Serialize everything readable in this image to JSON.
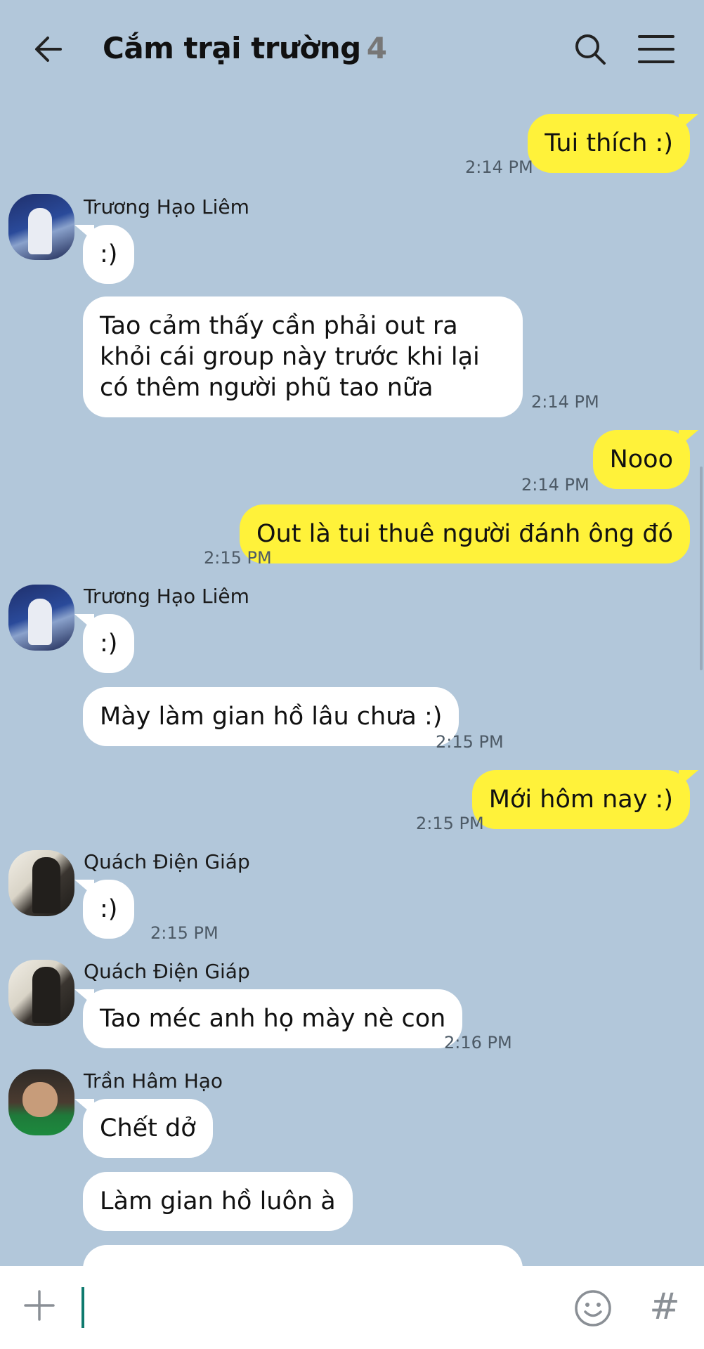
{
  "header": {
    "title": "Cắm trại trường",
    "member_count": "4",
    "icons": {
      "back": "back-arrow-icon",
      "search": "search-icon",
      "menu": "hamburger-menu-icon"
    }
  },
  "colors": {
    "background": "#b2c7da",
    "my_bubble": "#fff23a",
    "their_bubble": "#ffffff",
    "caret": "#0f7a6e"
  },
  "messages": [
    {
      "from": "me",
      "text": "Tui thích :)",
      "time": "2:14 PM"
    },
    {
      "from": "Trương Hạo Liêm",
      "sender_label": "Trương Hạo Liêm",
      "text": ":)"
    },
    {
      "from": "Trương Hạo Liêm",
      "text": "Tao cảm thấy cần phải out ra khỏi cái group này trước khi lại có thêm người phũ tao nữa",
      "time": "2:14 PM"
    },
    {
      "from": "me",
      "text": "Nooo",
      "time": "2:14 PM"
    },
    {
      "from": "me",
      "text": "Out là tui thuê người đánh ông đó",
      "time": "2:15 PM"
    },
    {
      "from": "Trương Hạo Liêm",
      "sender_label": "Trương Hạo Liêm",
      "text": ":)"
    },
    {
      "from": "Trương Hạo Liêm",
      "text": "Mày làm gian hồ lâu chưa :)",
      "time": "2:15 PM"
    },
    {
      "from": "me",
      "text": "Mới hôm nay :)",
      "time": "2:15 PM"
    },
    {
      "from": "Quách Điện Giáp",
      "sender_label": "Quách Điện Giáp",
      "text": ":)",
      "time": "2:15 PM"
    },
    {
      "from": "Quách Điện Giáp",
      "sender_label": "Quách Điện Giáp",
      "text": "Tao méc anh họ mày nè con",
      "time": "2:16 PM"
    },
    {
      "from": "Trần Hâm Hạo",
      "sender_label": "Trần Hâm Hạo",
      "text": "Chết dở"
    },
    {
      "from": "Trần Hâm Hạo",
      "text": "Làm gian hồ luôn à"
    }
  ],
  "input_bar": {
    "placeholder": "",
    "value": "",
    "icons": {
      "plus": "plus-icon",
      "emoji": "emoji-icon",
      "hashtag": "hashtag-icon"
    },
    "hash_glyph": "#"
  }
}
